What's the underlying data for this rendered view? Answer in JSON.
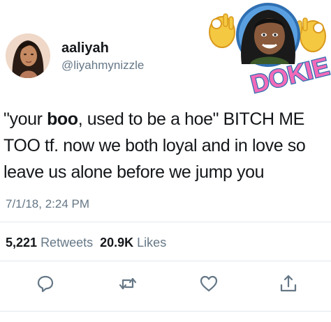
{
  "user": {
    "display_name": "aaliyah",
    "handle": "@liyahmynizzle"
  },
  "sticker": {
    "text": "DOKIE"
  },
  "tweet": {
    "line1_a": "\"your ",
    "line1_bold": "boo",
    "line1_b": ", used to be a hoe\" BITCH ME",
    "line2": "TOO tf. now we both loyal and in love so",
    "line3": "leave us alone before we jump you"
  },
  "timestamp": "7/1/18, 2:24 PM",
  "stats": {
    "retweets_count": "5,221",
    "retweets_label": "Retweets",
    "likes_count": "20.9K",
    "likes_label": "Likes"
  },
  "actions": [
    "reply-icon",
    "retweet-icon",
    "like-icon",
    "share-icon"
  ],
  "colors": {
    "text": "#14171a",
    "secondary": "#657786",
    "divider": "#e1e8ed",
    "sticker_pink": "#f26ab8",
    "sticker_blue": "#2f6fb1",
    "emoji_yellow": "#f5c842"
  }
}
